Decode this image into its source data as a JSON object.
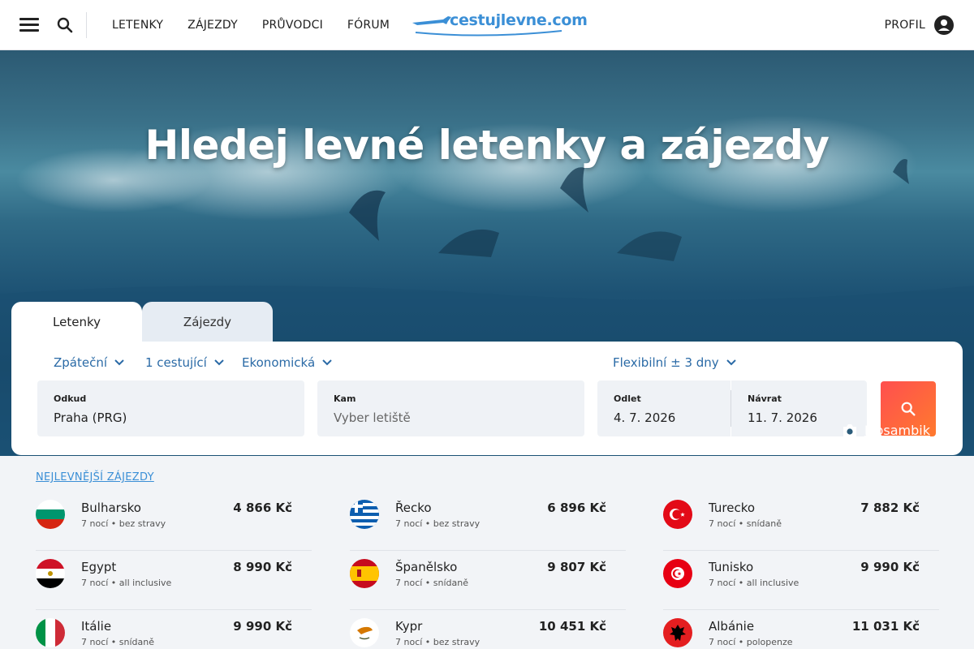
{
  "header": {
    "nav": [
      "LETENKY",
      "ZÁJEZDY",
      "PRŮVODCI",
      "FÓRUM"
    ],
    "logo_text": "cestujlevne.com",
    "profile_label": "PROFIL"
  },
  "hero": {
    "title": "Hledej levné letenky a zájezdy",
    "photo_caption": "Mosambik"
  },
  "search": {
    "tabs": [
      "Letenky",
      "Zájezdy"
    ],
    "active_tab": "Letenky",
    "trip_type": "Zpáteční",
    "travelers": "1 cestující",
    "cabin_class": "Ekonomická",
    "flexibility": "Flexibilní ± 3 dny",
    "from": {
      "label": "Odkud",
      "value": "Praha (PRG)"
    },
    "to": {
      "label": "Kam",
      "placeholder": "Vyber letiště"
    },
    "depart": {
      "label": "Odlet",
      "value": "4. 7. 2026"
    },
    "return": {
      "label": "Návrat",
      "value": "11. 7. 2026"
    }
  },
  "deals": {
    "title": "NEJLEVNĚJŠÍ ZÁJEZDY",
    "columns": [
      [
        {
          "country": "Bulharsko",
          "meta": "7 nocí • bez stravy",
          "price": "4 866 Kč",
          "flag": "bulgaria-flag"
        },
        {
          "country": "Egypt",
          "meta": "7 nocí • all inclusive",
          "price": "8 990 Kč",
          "flag": "egypt-flag"
        },
        {
          "country": "Itálie",
          "meta": "7 nocí • snídaně",
          "price": "9 990 Kč",
          "flag": "italy-flag"
        }
      ],
      [
        {
          "country": "Řecko",
          "meta": "7 nocí • bez stravy",
          "price": "6 896 Kč",
          "flag": "greece-flag"
        },
        {
          "country": "Španělsko",
          "meta": "7 nocí • snídaně",
          "price": "9 807 Kč",
          "flag": "spain-flag"
        },
        {
          "country": "Kypr",
          "meta": "7 nocí • bez stravy",
          "price": "10 451 Kč",
          "flag": "cyprus-flag"
        }
      ],
      [
        {
          "country": "Turecko",
          "meta": "7 nocí • snídaně",
          "price": "7 882 Kč",
          "flag": "turkey-flag"
        },
        {
          "country": "Tunisko",
          "meta": "7 nocí • all inclusive",
          "price": "9 990 Kč",
          "flag": "tunisia-flag"
        },
        {
          "country": "Albánie",
          "meta": "7 nocí • polopenze",
          "price": "11 031 Kč",
          "flag": "albania-flag"
        }
      ]
    ]
  },
  "colors": {
    "accent_blue": "#3b8fd6",
    "link_blue": "#2a6aa6",
    "search_button_from": "#ff4f4f",
    "search_button_to": "#ff7a2e"
  }
}
